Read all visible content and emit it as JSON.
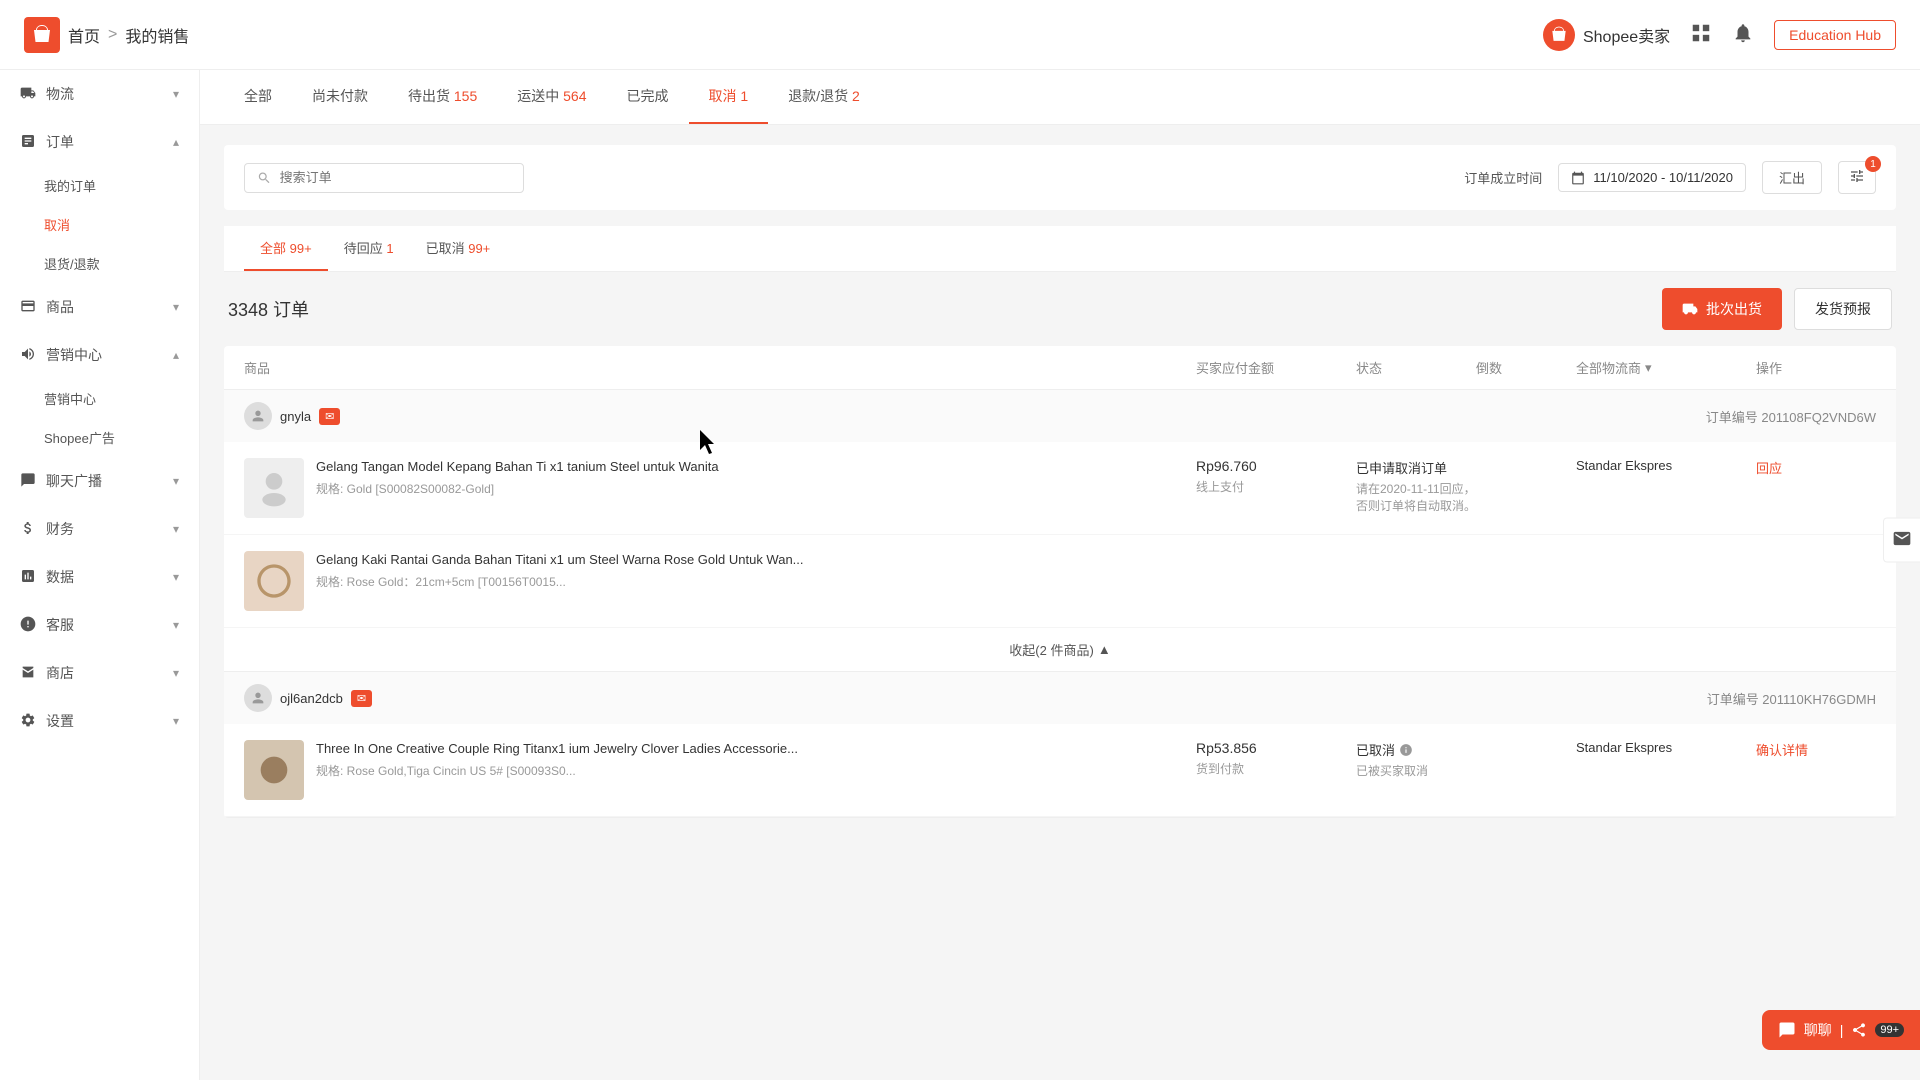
{
  "header": {
    "home_label": "首页",
    "separator": ">",
    "current_page": "我的销售",
    "seller_label": "Shopee卖家",
    "education_hub": "Education Hub"
  },
  "sidebar": {
    "items": [
      {
        "id": "wuliu",
        "label": "物流",
        "icon": "truck-icon",
        "expandable": true
      },
      {
        "id": "dingdan",
        "label": "订单",
        "icon": "order-icon",
        "expandable": true,
        "expanded": true,
        "children": [
          {
            "id": "my-orders",
            "label": "我的订单",
            "active": false
          },
          {
            "id": "cancel",
            "label": "取消",
            "active": true
          },
          {
            "id": "return",
            "label": "退货/退款",
            "active": false
          }
        ]
      },
      {
        "id": "shangpin",
        "label": "商品",
        "icon": "product-icon",
        "expandable": true
      },
      {
        "id": "yingxiao",
        "label": "营销中心",
        "icon": "marketing-icon",
        "expandable": true,
        "expanded": true,
        "children": [
          {
            "id": "marketing-center",
            "label": "营销中心",
            "active": false
          },
          {
            "id": "shopee-ads",
            "label": "Shopee广告",
            "active": false
          }
        ]
      },
      {
        "id": "zhibo",
        "label": "聊天广播",
        "icon": "broadcast-icon",
        "expandable": true
      },
      {
        "id": "caiwu",
        "label": "财务",
        "icon": "finance-icon",
        "expandable": true
      },
      {
        "id": "shuju",
        "label": "数据",
        "icon": "data-icon",
        "expandable": true
      },
      {
        "id": "kefu",
        "label": "客服",
        "icon": "service-icon",
        "expandable": true
      },
      {
        "id": "shangdian",
        "label": "商店",
        "icon": "store-icon",
        "expandable": true
      },
      {
        "id": "shezhi",
        "label": "设置",
        "icon": "settings-icon",
        "expandable": true
      }
    ]
  },
  "tabs": [
    {
      "id": "all",
      "label": "全部",
      "count": null
    },
    {
      "id": "unpaid",
      "label": "尚未付款",
      "count": null
    },
    {
      "id": "pending",
      "label": "待出货",
      "count": "155"
    },
    {
      "id": "shipping",
      "label": "运送中",
      "count": "564"
    },
    {
      "id": "done",
      "label": "已完成",
      "count": null
    },
    {
      "id": "cancel",
      "label": "取消",
      "count": "1",
      "active": true
    },
    {
      "id": "return",
      "label": "退款/退货",
      "count": "2"
    }
  ],
  "search": {
    "placeholder": "搜索订单"
  },
  "filter": {
    "date_label": "订单成立时间",
    "date_range": "11/10/2020 - 10/11/2020",
    "export_label": "汇出",
    "filter_badge": "1"
  },
  "sub_tabs": [
    {
      "id": "all",
      "label": "全部",
      "count": "99+",
      "active": true
    },
    {
      "id": "pending-reply",
      "label": "待回应",
      "count": "1"
    },
    {
      "id": "cancelled",
      "label": "已取消",
      "count": "99+"
    }
  ],
  "order_section": {
    "count_label": "3348 订单",
    "batch_ship_label": "批次出货",
    "forecast_label": "发货预报"
  },
  "table_headers": {
    "product": "商品",
    "amount": "买家应付金额",
    "status": "状态",
    "count": "倒数",
    "logistics": "全部物流商",
    "action": "操作"
  },
  "orders": [
    {
      "buyer": "gnyla",
      "order_number": "订单编号 201108FQ2VND6W",
      "items": [
        {
          "name": "Gelang Tangan Model Kepang Bahan Ti x1 tanium Steel untuk Wanita",
          "spec": "规格: Gold [S00082S00082-Gold]",
          "price": "Rp96.760",
          "payment": "线上支付",
          "status": "已申请取消订单",
          "status_desc": "请在2020-11-11回应，否则订单将自动取消。",
          "logistics": "Standar Ekspres",
          "action": "回应",
          "action_color": "#ee4d2d"
        },
        {
          "name": "Gelang Kaki Rantai Ganda Bahan Titani x1 um Steel Warna Rose Gold Untuk Wan...",
          "spec": "规格: Rose Gold：21cm+5cm [T00156T0015...",
          "price": "",
          "payment": "",
          "status": "",
          "status_desc": "",
          "logistics": "",
          "action": ""
        }
      ],
      "collapse_label": "收起(2 件商品)",
      "collapsed": false
    },
    {
      "buyer": "ojl6an2dcb",
      "order_number": "订单编号 201110KH76GDMH",
      "items": [
        {
          "name": "Three In One Creative Couple Ring Titanx1 ium Jewelry Clover Ladies Accessorie...",
          "spec": "规格: Rose Gold,Tiga Cincin US 5# [S00093S0...",
          "price": "Rp53.856",
          "payment": "货到付款",
          "status": "已取消",
          "status_desc": "已被买家取消",
          "logistics": "Standar Ekspres",
          "action": "确认详情",
          "action_color": "#ee4d2d"
        }
      ],
      "collapse_label": "",
      "collapsed": true
    }
  ],
  "chat_floating": {
    "label": "聊聊",
    "badge": "99+"
  }
}
